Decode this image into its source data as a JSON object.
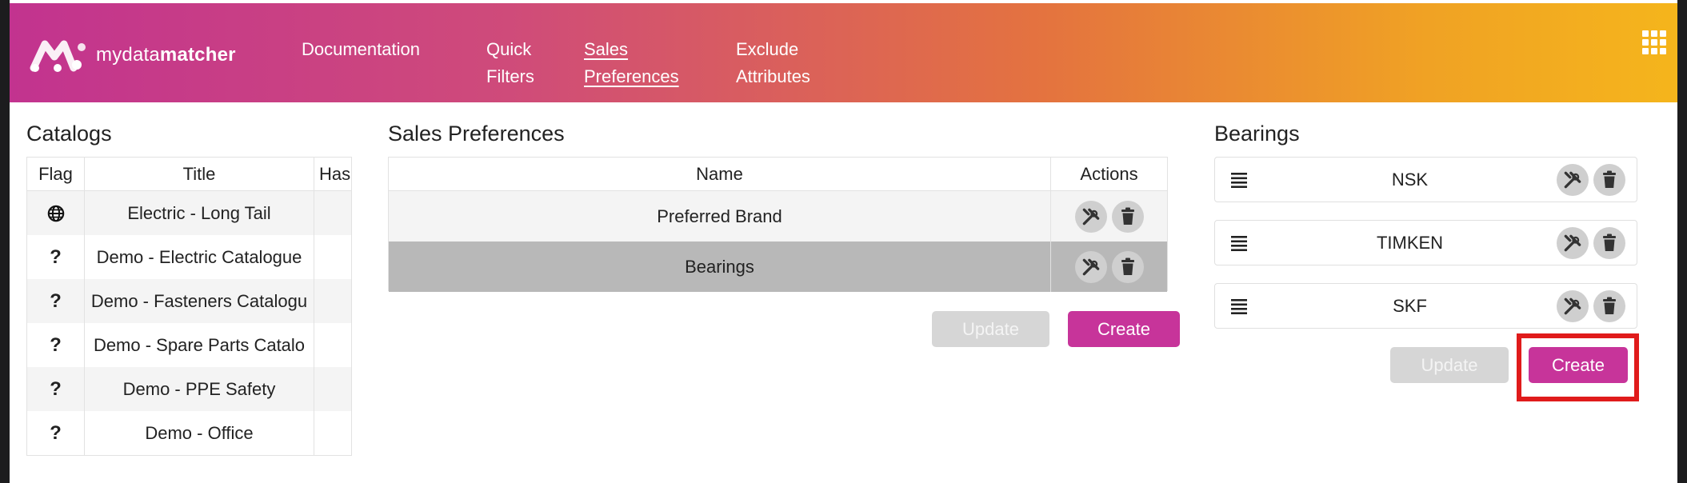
{
  "header": {
    "logo_text_regular": "mydata",
    "logo_text_bold": "matcher",
    "nav": [
      {
        "line1": "Documentation",
        "line2": ""
      },
      {
        "line1": "Quick",
        "line2": "Filters"
      },
      {
        "line1": "Sales",
        "line2": "Preferences",
        "active": true
      },
      {
        "line1": "Exclude",
        "line2": "Attributes"
      }
    ],
    "apps_icon": "grid-apps-icon"
  },
  "catalogs": {
    "title": "Catalogs",
    "columns": [
      "Flag",
      "Title",
      "Has"
    ],
    "rows": [
      {
        "flag": "globe",
        "title": "Electric - Long Tail"
      },
      {
        "flag": "?",
        "title": "Demo - Electric Catalogue"
      },
      {
        "flag": "?",
        "title": "Demo - Fasteners Catalogu"
      },
      {
        "flag": "?",
        "title": "Demo - Spare Parts Catalo"
      },
      {
        "flag": "?",
        "title": "Demo - PPE Safety"
      },
      {
        "flag": "?",
        "title": "Demo - Office"
      }
    ]
  },
  "sales_preferences": {
    "title": "Sales Preferences",
    "columns": [
      "Name",
      "Actions"
    ],
    "rows": [
      {
        "name": "Preferred Brand"
      },
      {
        "name": "Bearings",
        "selected": true
      }
    ],
    "update_label": "Update",
    "create_label": "Create"
  },
  "bearings": {
    "title": "Bearings",
    "items": [
      "NSK",
      "TIMKEN",
      "SKF"
    ],
    "update_label": "Update",
    "create_label": "Create"
  },
  "colors": {
    "primary": "#c7349a",
    "gradient_start": "#c2338f",
    "gradient_end": "#f5b51c",
    "highlight": "#e01b1b"
  }
}
